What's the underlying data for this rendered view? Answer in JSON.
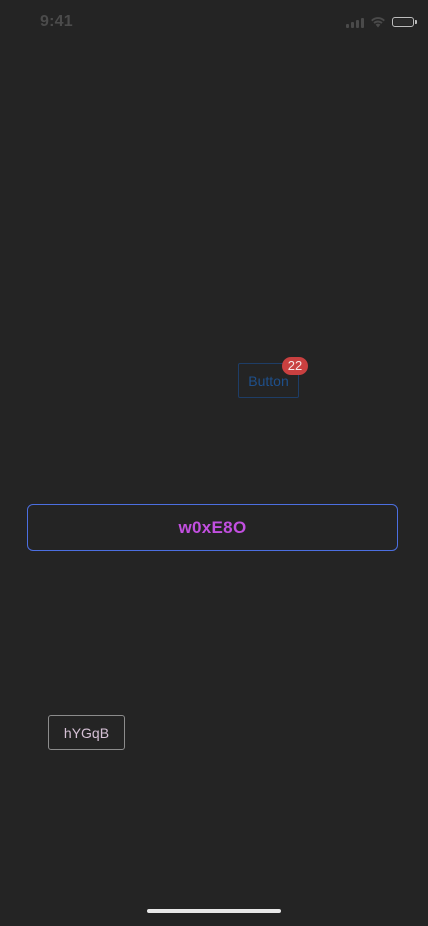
{
  "status_bar": {
    "time": "9:41",
    "icons": [
      "cellular-signal-icon",
      "wifi-icon",
      "battery-icon"
    ]
  },
  "buttons": {
    "ghost": {
      "label": "Button",
      "badge_count": "22"
    },
    "primary_outline": {
      "label": "w0xE8O"
    },
    "small_outline": {
      "label": "hYGqB"
    }
  },
  "colors": {
    "background": "#242424",
    "primary_border": "#4c6fe0",
    "primary_text": "#c24fe0",
    "badge": "#c94040",
    "ghost_text": "#1e4f8a"
  }
}
